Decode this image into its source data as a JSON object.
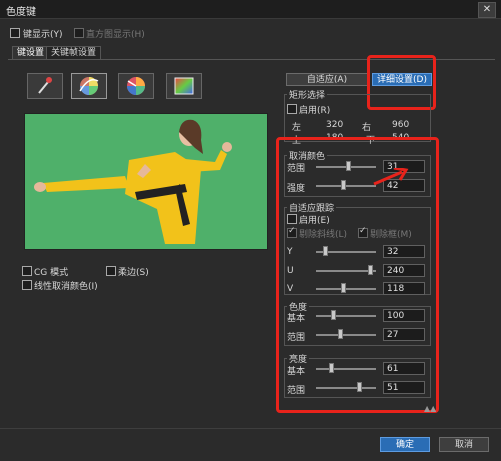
{
  "window": {
    "title": "色度键",
    "close_glyph": "✕"
  },
  "top_options": {
    "key_display": {
      "label": "键显示(Y)",
      "checked": false
    },
    "histogram_display": {
      "label": "直方图显示(H)",
      "checked": false,
      "disabled": true
    }
  },
  "tabs": [
    {
      "label": "键设置",
      "active": true
    },
    {
      "label": "关键帧设置",
      "active": false
    }
  ],
  "tools": [
    "eyedropper-tool",
    "color-wheel-tool",
    "hue-range-tool",
    "color-gradient-tool"
  ],
  "preview_options": {
    "cg_mode": {
      "label": "CG 模式",
      "checked": false
    },
    "soft_edge": {
      "label": "柔边(S)",
      "checked": false
    },
    "linear_key": {
      "label": "线性取消颜色(I)",
      "checked": false
    }
  },
  "buttons": {
    "adaptive": "自适应(A)",
    "detail": "详细设置(D)",
    "ok": "确定",
    "cancel": "取消"
  },
  "rect_select": {
    "title": "矩形选择",
    "enable": {
      "label": "启用(R)",
      "checked": false
    },
    "left_label": "左",
    "left_value": "320",
    "right_label": "右",
    "right_value": "960",
    "top_label": "上",
    "top_value": "180",
    "bottom_label": "下",
    "bottom_value": "540"
  },
  "cancel_color": {
    "title": "取消颜色",
    "rows": [
      {
        "label": "范围",
        "value": "31",
        "level": 0.55
      },
      {
        "label": "强度",
        "value": "42",
        "level": 0.45
      }
    ]
  },
  "adaptive_track": {
    "title": "自适应跟踪",
    "enable": {
      "label": "启用(E)",
      "checked": false
    },
    "remove_noise": {
      "label": "剔除斜线(L)",
      "checked": true
    },
    "remove_edge": {
      "label": "剔除框(M)",
      "checked": true
    },
    "rows": [
      {
        "label": "Y",
        "value": "32",
        "level": 0.12
      },
      {
        "label": "U",
        "value": "240",
        "level": 0.94
      },
      {
        "label": "V",
        "value": "118",
        "level": 0.46
      }
    ]
  },
  "hue": {
    "title": "色度",
    "rows": [
      {
        "label": "基本",
        "value": "100",
        "level": 0.28
      },
      {
        "label": "范围",
        "value": "27",
        "level": 0.4
      }
    ]
  },
  "brightness": {
    "title": "亮度",
    "rows": [
      {
        "label": "基本",
        "value": "61",
        "level": 0.24
      },
      {
        "label": "范围",
        "value": "51",
        "level": 0.75
      }
    ]
  },
  "highlight_color": "#e8231b"
}
